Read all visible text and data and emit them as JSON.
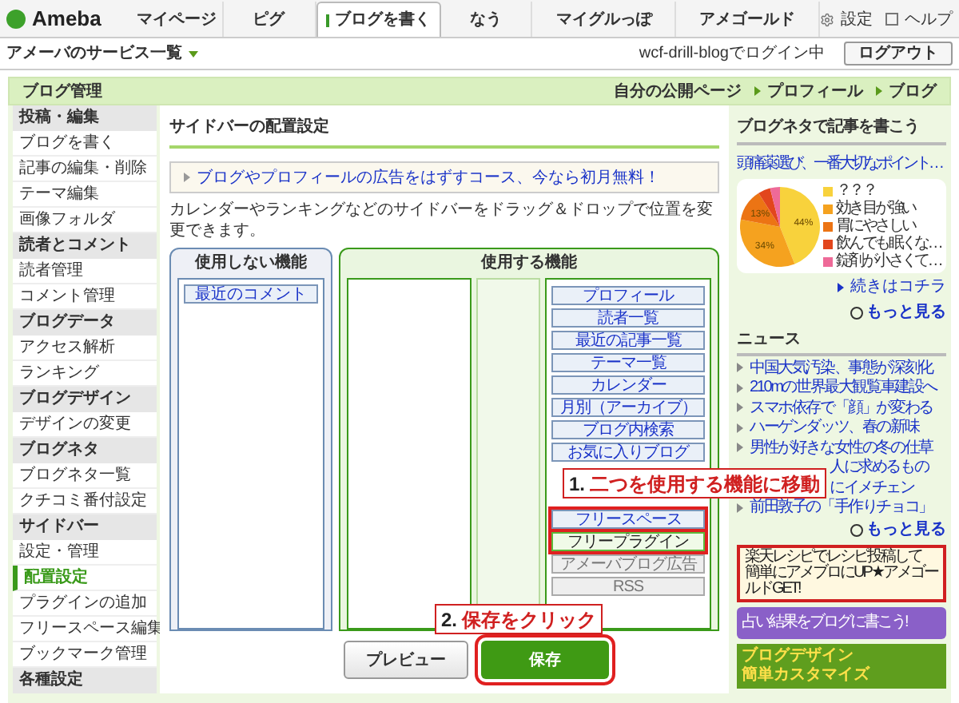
{
  "header": {
    "logo": "Ameba",
    "tabs": [
      {
        "label": "マイページ",
        "selected": false,
        "kind": "plain"
      },
      {
        "label": "ピグ",
        "selected": false,
        "kind": "plain"
      },
      {
        "label": "ブログを書く",
        "selected": true,
        "kind": "write"
      },
      {
        "label": "なう",
        "selected": false,
        "kind": "plain"
      },
      {
        "label": "マイグルっぽ",
        "selected": false,
        "kind": "plain"
      },
      {
        "label": "アメゴールド",
        "selected": false,
        "kind": "plain"
      }
    ],
    "settings": "設定",
    "help": "ヘルプ"
  },
  "subbar": {
    "services": "アメーバのサービス一覧",
    "login_status": "wcf-drill-blogでログイン中",
    "logout": "ログアウト"
  },
  "title_bar": {
    "title": "ブログ管理",
    "links": [
      "自分の公開ページ",
      "プロフィール",
      "ブログ"
    ]
  },
  "sidebar": [
    {
      "header": "投稿・編集",
      "items": [
        {
          "label": "ブログを書く",
          "selected": false
        },
        {
          "label": "記事の編集・削除",
          "selected": false
        },
        {
          "label": "テーマ編集",
          "selected": false
        },
        {
          "label": "画像フォルダ",
          "selected": false
        }
      ]
    },
    {
      "header": "読者とコメント",
      "items": [
        {
          "label": "読者管理",
          "selected": false
        },
        {
          "label": "コメント管理",
          "selected": false
        }
      ]
    },
    {
      "header": "ブログデータ",
      "items": [
        {
          "label": "アクセス解析",
          "selected": false
        },
        {
          "label": "ランキング",
          "selected": false
        }
      ]
    },
    {
      "header": "ブログデザイン",
      "items": [
        {
          "label": "デザインの変更",
          "selected": false
        }
      ]
    },
    {
      "header": "ブログネタ",
      "items": [
        {
          "label": "ブログネタ一覧",
          "selected": false
        },
        {
          "label": "クチコミ番付設定",
          "selected": false
        }
      ]
    },
    {
      "header": "サイドバー",
      "items": [
        {
          "label": "設定・管理",
          "selected": false
        },
        {
          "label": "配置設定",
          "selected": true
        },
        {
          "label": "プラグインの追加",
          "selected": false
        },
        {
          "label": "フリースペース編集",
          "selected": false
        },
        {
          "label": "ブックマーク管理",
          "selected": false
        }
      ]
    },
    {
      "header": "各種設定"
    }
  ],
  "main": {
    "title": "サイドバーの配置設定",
    "notice": "ブログやプロフィールの広告をはずすコース、今なら初月無料！",
    "description": "カレンダーやランキングなどのサイドバーをドラッグ＆ドロップで位置を変更できます。",
    "unused_panel": {
      "title": "使用しない機能",
      "widgets": [
        "最近のコメント"
      ]
    },
    "used_panel": {
      "title": "使用する機能",
      "widgets": [
        {
          "label": "プロフィール",
          "kind": "normal"
        },
        {
          "label": "読者一覧",
          "kind": "normal"
        },
        {
          "label": "最近の記事一覧",
          "kind": "normal"
        },
        {
          "label": "テーマ一覧",
          "kind": "normal"
        },
        {
          "label": "カレンダー",
          "kind": "normal"
        },
        {
          "label": "月別（アーカイブ）",
          "kind": "normal"
        },
        {
          "label": "ブログ内検索",
          "kind": "normal"
        },
        {
          "label": "お気に入りブログ",
          "kind": "normal"
        },
        {
          "kind": "covered"
        },
        {
          "kind": "covered"
        },
        {
          "label": "フリースペース",
          "kind": "highlighted"
        },
        {
          "label": "フリープラグイン",
          "kind": "new"
        },
        {
          "label": "アメーバブログ広告",
          "kind": "fixed"
        },
        {
          "label": "RSS",
          "kind": "fixed"
        }
      ]
    },
    "buttons": {
      "preview": "プレビュー",
      "save": "保存"
    },
    "annotations": [
      {
        "number": "1.",
        "text": "二つを使用する機能に移動"
      },
      {
        "number": "2.",
        "text": "保存をクリック"
      }
    ]
  },
  "right": {
    "neta_heading": "ブログネタで記事を書こう",
    "neta_title": "頭痛薬選び、一番大切なポイント…",
    "chart_data": {
      "type": "pie",
      "legend": "right",
      "categories": [
        "？？？",
        "効き目が強い",
        "胃にやさしい",
        "飲んでも眠くな…",
        "錠剤が小さくて…"
      ],
      "values": [
        44,
        34,
        13,
        5,
        4
      ],
      "value_labels": [
        "44%",
        "34%",
        "13%",
        null,
        null
      ],
      "colors": [
        "#f8d23c",
        "#f5a21f",
        "#ec7414",
        "#e2461d",
        "#ee6a98"
      ]
    },
    "more_results": "続きはコチラ",
    "more": "もっと見る",
    "news_heading": "ニュース",
    "news": [
      {
        "text": "中国大気汚染、事態が深刻化",
        "kind": "full"
      },
      {
        "text": "210mの世界最大観覧車建設へ",
        "kind": "full"
      },
      {
        "text": "スマホ依存で「顔」が変わる",
        "kind": "full"
      },
      {
        "text": "ハーゲンダッツ、春の新味",
        "kind": "full"
      },
      {
        "text": "男性が好きな女性の冬の仕草",
        "kind": "full"
      },
      {
        "text": "人に求めるもの",
        "kind": "partial"
      },
      {
        "text": "にイメチェン",
        "kind": "partial"
      },
      {
        "text": "前田敦子の「手作りチョコ」",
        "kind": "full"
      }
    ],
    "news_more": "もっと見る",
    "banners": [
      {
        "kind": "recipe",
        "lines": [
          "楽天レシピでレシピ投稿して",
          "簡単にアメブロにUP★アメゴールドGET!"
        ]
      },
      {
        "kind": "fortune",
        "lines": [
          "占い結果をブログに書こう!"
        ]
      },
      {
        "kind": "design",
        "lines": [
          "ブログデザイン",
          "簡単カスタマイズ"
        ]
      }
    ]
  }
}
